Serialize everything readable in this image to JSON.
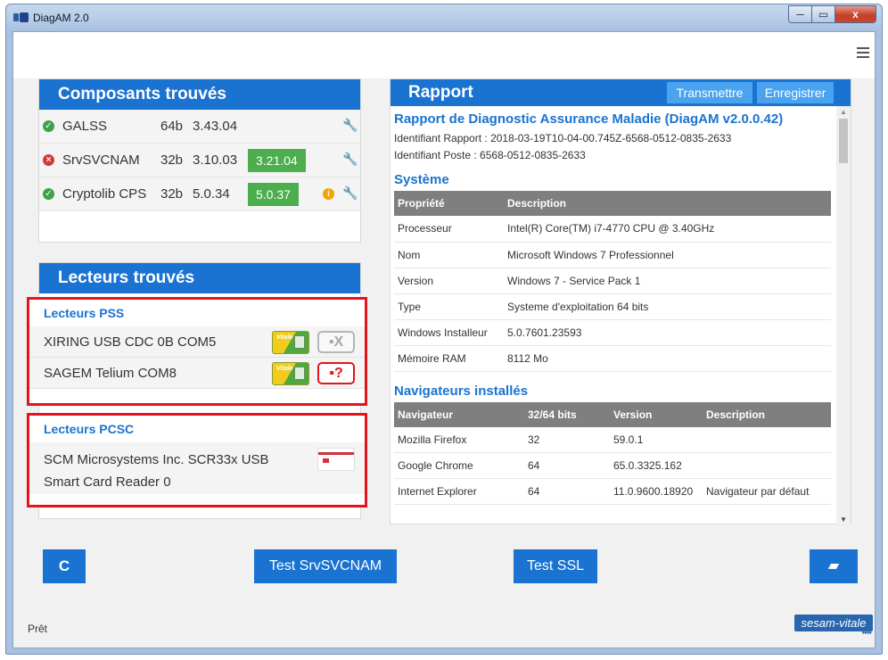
{
  "window": {
    "title": "DiagAM 2.0",
    "minimize": "─",
    "maximize": "▭",
    "close": "x"
  },
  "composants": {
    "title": "Composants trouvés",
    "rows": [
      {
        "name": "GALSS",
        "arch": "64b",
        "version": "3.43.04",
        "new_version": "",
        "status": "ok"
      },
      {
        "name": "SrvSVCNAM",
        "arch": "32b",
        "version": "3.10.03",
        "new_version": "3.21.04",
        "status": "error"
      },
      {
        "name": "Cryptolib CPS",
        "arch": "32b",
        "version": "5.0.34",
        "new_version": "5.0.37",
        "status": "ok"
      }
    ]
  },
  "lecteurs": {
    "title": "Lecteurs trouvés",
    "pss_title": "Lecteurs PSS",
    "pss": [
      {
        "name": "XIRING USB CDC 0B COM5",
        "state": "▪X"
      },
      {
        "name": "SAGEM Telium COM8",
        "state": "▪?"
      }
    ],
    "card_label": "Vitale",
    "pcsc_title": "Lecteurs PCSC",
    "pcsc": [
      {
        "name": "SCM Microsystems Inc. SCR33x USB Smart Card Reader 0"
      }
    ]
  },
  "rapport": {
    "title": "Rapport",
    "btn_transmettre": "Transmettre",
    "btn_enregistrer": "Enregistrer",
    "heading": "Rapport de Diagnostic Assurance Maladie (DiagAM v2.0.0.42)",
    "id_rapport": "Identifiant Rapport : 2018-03-19T10-04-00.745Z-6568-0512-0835-2633",
    "id_poste": "Identifiant Poste : 6568-0512-0835-2633",
    "systeme": {
      "title": "Système",
      "headers": [
        "Propriété",
        "Description"
      ],
      "rows": [
        [
          "Processeur",
          "Intel(R) Core(TM) i7-4770 CPU @ 3.40GHz"
        ],
        [
          "Nom",
          "Microsoft Windows 7 Professionnel"
        ],
        [
          "Version",
          "Windows 7 - Service Pack 1"
        ],
        [
          "Type",
          "Systeme d'exploitation 64 bits"
        ],
        [
          "Windows Installeur",
          "5.0.7601.23593"
        ],
        [
          "Mémoire RAM",
          "8112 Mo"
        ]
      ]
    },
    "navigateurs": {
      "title": "Navigateurs installés",
      "headers": [
        "Navigateur",
        "32/64 bits",
        "Version",
        "Description"
      ],
      "rows": [
        [
          "Mozilla Firefox",
          "32",
          "59.0.1",
          ""
        ],
        [
          "Google Chrome",
          "64",
          "65.0.3325.162",
          ""
        ],
        [
          "Internet Explorer",
          "64",
          "11.0.9600.18920",
          "Navigateur par défaut"
        ]
      ]
    }
  },
  "buttons": {
    "refresh": "C",
    "test_srv": "Test SrvSVCNAM",
    "test_ssl": "Test SSL",
    "folder": "▰"
  },
  "status": "Prêt",
  "logo": {
    "text": "sesam-vitale",
    "dots": "●●●●"
  },
  "colors": {
    "accent": "#1a73d1",
    "ok": "#3da24a",
    "error": "#d33b3b",
    "highlight": "#e3141b",
    "update": "#4cae4c"
  }
}
